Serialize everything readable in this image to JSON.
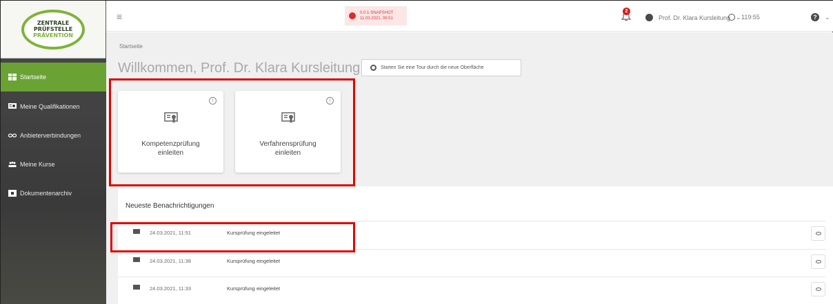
{
  "logo": {
    "line1": "ZENTRALE",
    "line2": "PRÜFSTELLE",
    "line3": "PRÄVENTION"
  },
  "sidebar": {
    "items": [
      {
        "label": "Startseite",
        "icon": "dashboard-icon",
        "active": true
      },
      {
        "label": "Meine Qualifikationen",
        "icon": "qualification-icon",
        "active": false
      },
      {
        "label": "Anbieterverbindungen",
        "icon": "link-icon",
        "active": false
      },
      {
        "label": "Meine Kurse",
        "icon": "group-icon",
        "active": false
      },
      {
        "label": "Dokumentenarchiv",
        "icon": "archive-icon",
        "active": false
      }
    ]
  },
  "topbar": {
    "menu_icon": "≡",
    "snapshot_version": "0.0.1-SNAPSHOT",
    "snapshot_date": "11.03.2021, 08:51",
    "notification_count": "2",
    "user_name": "Prof. Dr. Klara Kursleitung",
    "session_timer": "119:55",
    "help_label": "?"
  },
  "main": {
    "breadcrumb": "Startseite",
    "welcome": "Willkommen, Prof. Dr. Klara Kursleitung!",
    "tour_button": "Starten Sie eine Tour durch die neue Oberfläche",
    "cards": [
      {
        "line1": "Kompetenzprüfung",
        "line2": "einleiten"
      },
      {
        "line1": "Verfahrensprüfung",
        "line2": "einleiten"
      }
    ],
    "notifications_title": "Neueste Benachrichtigungen",
    "notifications": [
      {
        "date": "24.03.2021, 11:51",
        "message": "Kursprüfung eingeleitet"
      },
      {
        "date": "24.03.2021, 11:38",
        "message": "Kursprüfung eingeleitet"
      },
      {
        "date": "24.03.2021, 11:33",
        "message": "Kursprüfung eingeleitet"
      }
    ]
  },
  "colors": {
    "accent_green": "#6aa334",
    "highlight_red": "#e00000",
    "sidebar_bg": "#3a3a3a"
  }
}
